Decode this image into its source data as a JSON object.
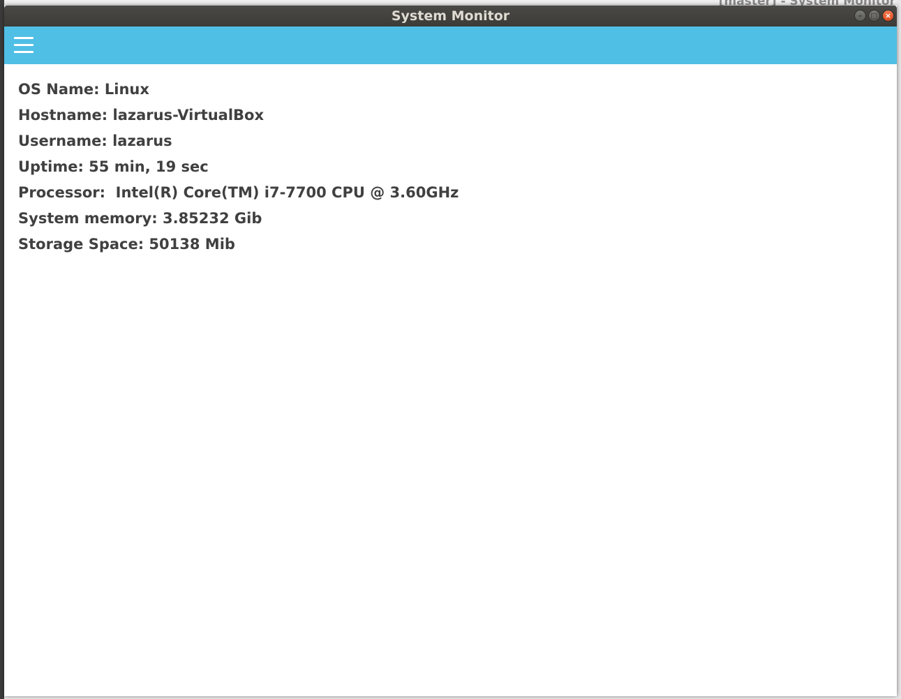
{
  "background_window": {
    "title": "[master] - System Monitor"
  },
  "window": {
    "title": "System Monitor",
    "buttons": {
      "minimize": "–",
      "maximize": "□",
      "close": "×"
    }
  },
  "toolbar": {
    "color": "#50bfe6",
    "menu_icon": "hamburger-menu-icon"
  },
  "info": {
    "os_name": "OS Name: Linux",
    "hostname": "Hostname: lazarus-VirtualBox",
    "username": "Username: lazarus",
    "uptime": "Uptime: 55 min, 19 sec",
    "processor": "Processor:  Intel(R) Core(TM) i7-7700 CPU @ 3.60GHz",
    "system_memory": "System memory: 3.85232 Gib",
    "storage_space": "Storage Space: 50138 Mib"
  }
}
